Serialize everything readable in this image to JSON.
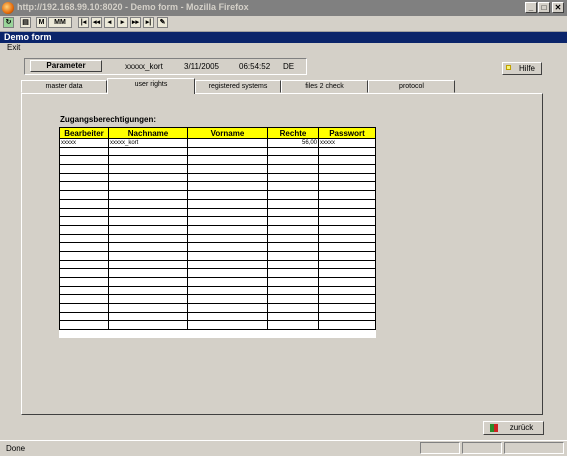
{
  "window": {
    "title": "http://192.168.99.10:8020 - Demo form - Mozilla Firefox",
    "min": "_",
    "max": "□",
    "close": "✕"
  },
  "toolbar": {
    "buttons": [
      "reload",
      "print",
      "find",
      "find-next",
      "first",
      "prev-page",
      "prev",
      "next",
      "next-page",
      "last",
      "edit"
    ]
  },
  "app": {
    "title": "Demo form",
    "menu_exit": "Exit"
  },
  "info": {
    "parameter_label": "Parameter",
    "user": "xxxxx_kort",
    "date": "3/11/2005",
    "time": "06:54:52",
    "lang": "DE",
    "help_label": "Hilfe"
  },
  "tabs": [
    "master data",
    "user rights",
    "registered systems",
    "files 2 check",
    "protocol"
  ],
  "section_label": "Zugangsberechtigungen:",
  "table": {
    "headers": [
      "Bearbeiter",
      "Nachname",
      "Vorname",
      "Rechte",
      "Passwort"
    ],
    "rows": [
      [
        "xxxxx",
        "xxxxx_kort",
        "",
        "56,00",
        "xxxxx"
      ]
    ],
    "empty_rows": 21
  },
  "back_label": "zurück",
  "status": "Done"
}
